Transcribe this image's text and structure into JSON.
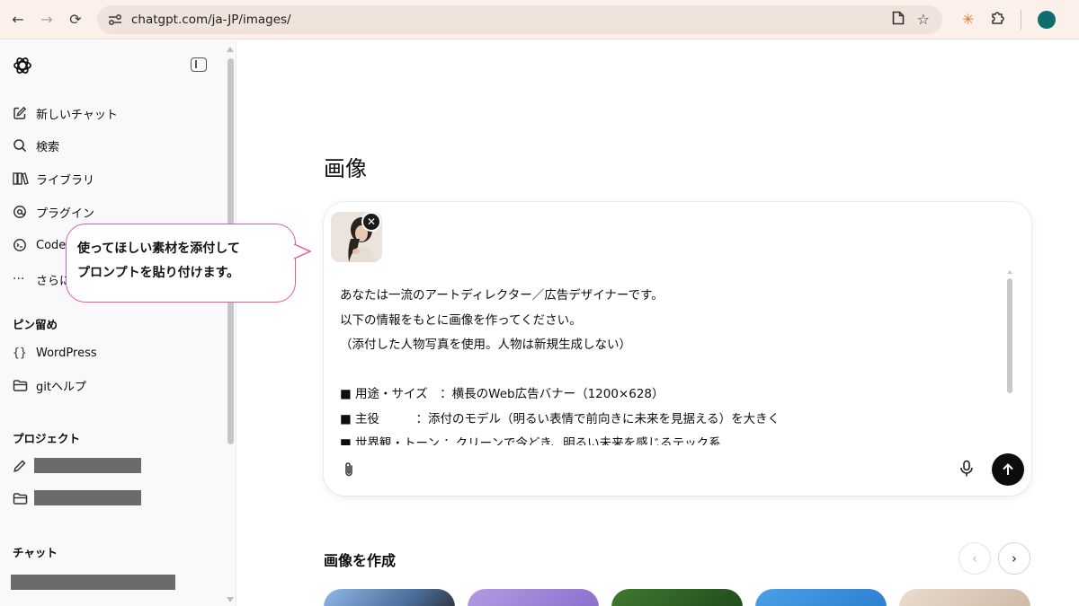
{
  "browser": {
    "back_icon": "←",
    "forward_icon": "→",
    "reload_icon": "⟳",
    "url": "chatgpt.com/ja-JP/images/"
  },
  "sidebar": {
    "nav": [
      {
        "icon": "edit-icon",
        "label": "新しいチャット"
      },
      {
        "icon": "search-icon",
        "label": "検索"
      },
      {
        "icon": "library-icon",
        "label": "ライブラリ"
      },
      {
        "icon": "plugin-icon",
        "label": "プラグイン"
      },
      {
        "icon": "codex-icon",
        "label": "Code"
      },
      {
        "icon": "more-icon",
        "label": "さらに"
      }
    ],
    "pinned_heading": "ピン留め",
    "pinned": [
      {
        "icon": "braces-icon",
        "label": "WordPress"
      },
      {
        "icon": "folder-icon",
        "label": "gitヘルプ"
      }
    ],
    "projects_heading": "プロジェクト",
    "chats_heading": "チャット"
  },
  "callout": {
    "line1": "使ってほしい素材を添付して",
    "line2": "プロンプトを貼り付けます。"
  },
  "main": {
    "title": "画像",
    "prompt_text": "あなたは一流のアートディレクター／広告デザイナーです。\n以下の情報をもとに画像を作ってください。\n（添付した人物写真を使用。人物は新規生成しない）\n\n■ 用途・サイズ　：横長のWeb広告バナー（1200×628）\n■ 主役　　　：添付のモデル（明るい表情で前向きに未来を見据える）を大きく\n■ 世界観・トーン ：クリーンで今どき、明るい未来を感じるテック系",
    "create_section_title": "画像を作成"
  },
  "colors": {
    "callout_border": "#e25aa6",
    "send_button": "#0d0d0d",
    "profile_avatar": "#0e6e6e",
    "extension_icon": "#e0772a"
  }
}
